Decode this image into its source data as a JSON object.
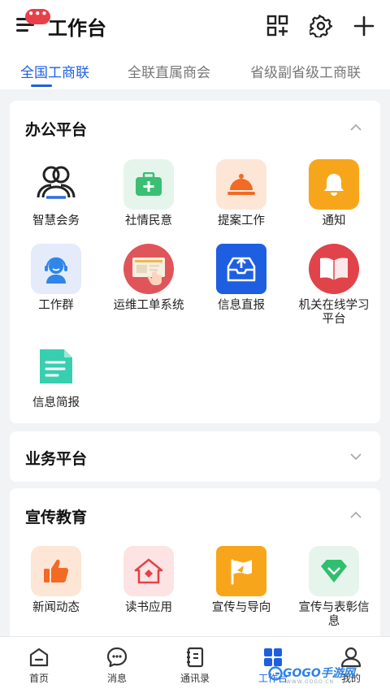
{
  "header": {
    "badge": "•••",
    "title": "工作台"
  },
  "tabs": [
    {
      "label": "全国工商联",
      "active": true
    },
    {
      "label": "全联直属商会",
      "active": false
    },
    {
      "label": "省级副省级工商联",
      "active": false
    }
  ],
  "office": {
    "title": "办公平台",
    "items": [
      {
        "label": "智慧会务",
        "icon": "meeting-people-icon"
      },
      {
        "label": "社情民意",
        "icon": "medical-kit-icon"
      },
      {
        "label": "提案工作",
        "icon": "service-bell-icon"
      },
      {
        "label": "通知",
        "icon": "bell-icon"
      },
      {
        "label": "工作群",
        "icon": "headset-user-icon"
      },
      {
        "label": "运维工单系统",
        "icon": "monitor-touch-icon"
      },
      {
        "label": "信息直报",
        "icon": "upload-tray-icon"
      },
      {
        "label": "机关在线学习平台",
        "icon": "open-book-icon"
      },
      {
        "label": "信息简报",
        "icon": "document-icon"
      }
    ]
  },
  "business": {
    "title": "业务平台"
  },
  "publicity": {
    "title": "宣传教育",
    "items": [
      {
        "label": "新闻动态",
        "icon": "thumbs-up-icon"
      },
      {
        "label": "读书应用",
        "icon": "house-icon"
      },
      {
        "label": "宣传与导向",
        "icon": "flag-icon"
      },
      {
        "label": "宣传与表彰信息",
        "icon": "diamond-icon"
      }
    ]
  },
  "tabbar": [
    {
      "label": "首页",
      "icon": "home-icon"
    },
    {
      "label": "消息",
      "icon": "chat-icon"
    },
    {
      "label": "通讯录",
      "icon": "contacts-icon"
    },
    {
      "label": "工作台",
      "icon": "grid-icon",
      "active": true
    },
    {
      "label": "我的",
      "icon": "user-icon"
    }
  ],
  "watermark": {
    "text": "GOGO手游网",
    "sub": "WWW.GOGO.CN"
  },
  "colors": {
    "accent": "#1d5fe0",
    "badge": "#e8404a"
  }
}
